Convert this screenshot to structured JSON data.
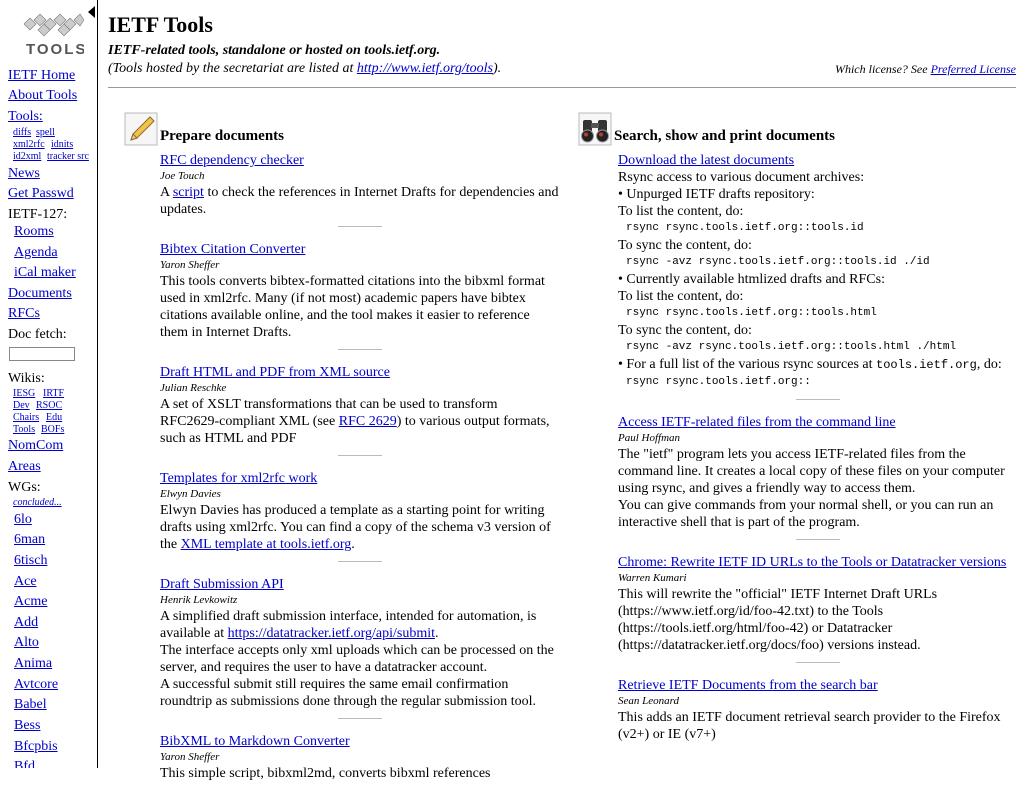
{
  "header": {
    "title": "IETF Tools",
    "subtitle": "IETF-related tools, standalone or hosted on tools.ietf.org.",
    "note_prefix": "(Tools hosted by the secretariat are listed at ",
    "note_link": "http://www.ietf.org/tools",
    "note_suffix": ").",
    "license_prefix": "Which license? See ",
    "license_link": "Preferred License"
  },
  "sidebar": {
    "ietf_home": "IETF Home",
    "about_tools": "About Tools",
    "tools_label": "Tools:",
    "tool_links": [
      "diffs",
      "spell",
      "xml2rfc",
      "idnits",
      "id2xml",
      "tracker src"
    ],
    "news": "News",
    "get_passwd": "Get Passwd",
    "ietf127_label": "IETF-127:",
    "ietf127_links": [
      "Rooms",
      "Agenda",
      "iCal maker"
    ],
    "documents": "Documents",
    "rfcs": "RFCs",
    "doc_fetch_label": "Doc fetch:",
    "wikis_label": "Wikis:",
    "wiki_links": [
      "IESG",
      "IRTF",
      "Dev",
      "RSOC",
      "Chairs",
      "Edu",
      "Tools",
      "BOFs"
    ],
    "nomcom": "NomCom",
    "areas": "Areas",
    "wgs_label": "WGs:",
    "concluded": "concluded...",
    "wg_links": [
      "6lo",
      "6man",
      "6tisch",
      "Ace",
      "Acme",
      "Add",
      "Alto",
      "Anima",
      "Avtcore",
      "Babel",
      "Bess",
      "Bfcpbis",
      "Bfd"
    ]
  },
  "left_section": {
    "title": "Prepare documents",
    "icon": "pencil-document-icon",
    "entries": [
      {
        "title": "RFC dependency checker",
        "author": "Joe Touch",
        "desc": [
          "A ",
          "script",
          " to check the references in Internet Drafts for dependencies and updates."
        ]
      },
      {
        "title": "Bibtex Citation Converter",
        "author": "Yaron Sheffer",
        "desc": [
          "This tools converts bibtex-formatted citations into the bibxml format used in xml2rfc. Many (if not most) academic papers have bibtex citations available online, and the tool makes it easier to reference them in Internet Drafts."
        ]
      },
      {
        "title": "Draft HTML and PDF from XML source",
        "author": "Julian Reschke",
        "desc": [
          "A set of XSLT transformations that can be used to transform RFC2629-compliant XML (see ",
          "RFC 2629",
          ") to various output formats, such as HTML and PDF"
        ]
      },
      {
        "title": "Templates for xml2rfc work",
        "author": "Elwyn Davies",
        "desc": [
          "Elwyn Davies has produced a template as a starting point for writing drafts using xml2rfc. You can find a copy of the schema v3 version of the ",
          "XML template at tools.ietf.org",
          "."
        ]
      },
      {
        "title": "Draft Submission API",
        "author": "Henrik Levkowitz",
        "desc": [
          "A simplified draft submission interface, intended for automation, is available at ",
          "https://datatracker.ietf.org/api/submit",
          ".",
          "The interface accepts only xml uploads which can be processed on the server, and requires the user to have a datatracker account.",
          "A successful submit still requires the same email confirmation roundtrip as submissions done through the regular submission tool."
        ]
      },
      {
        "title": "BibXML to Markdown Converter",
        "author": "Yaron Sheffer",
        "desc": [
          "This simple script, bibxml2md, converts bibxml references"
        ]
      }
    ]
  },
  "right_section": {
    "title": "Search, show and print documents",
    "icon": "binoculars-icon",
    "rsync": {
      "title": "Download the latest documents",
      "intro": "Rsync access to various document archives:",
      "unpurged": "• Unpurged IETF drafts repository:",
      "list_label": "To list the content, do:",
      "cmd1": "rsync rsync.tools.ietf.org::tools.id",
      "sync_label": "To sync the content, do:",
      "cmd2": "rsync -avz rsync.tools.ietf.org::tools.id ./id",
      "htmlized": "• Currently available htmlized drafts and RFCs:",
      "list_label2": "To list the content, do:",
      "cmd3": "rsync rsync.tools.ietf.org::tools.html",
      "sync_label2": "To sync the content, do:",
      "cmd4": "rsync -avz rsync.tools.ietf.org::tools.html ./html",
      "full_list_a": "• For a full list of the various rsync sources at ",
      "full_list_code": "tools.ietf.org",
      "full_list_b": ", do:",
      "cmd5": "rsync rsync.tools.ietf.org::"
    },
    "entries": [
      {
        "title": "Access IETF-related files from the command line",
        "author": "Paul Hoffman",
        "desc": [
          "The \"ietf\" program lets you access IETF-related files from the command line. It creates a local copy of these files on your computer using rsync, and gives a friendly way to access them.",
          "You can give commands from your normal shell, or you can run an interactive shell that is part of the program."
        ]
      },
      {
        "title": "Chrome: Rewrite IETF ID URLs to the Tools or Datatracker versions",
        "author": "Warren Kumari",
        "desc": [
          "This will rewrite the \"official\" IETF Internet Draft URLs (https://www.ietf.org/id/foo-42.txt) to the Tools (https://tools.ietf.org/html/foo-42) or Datatracker (https://datatracker.ietf.org/docs/foo) versions instead."
        ]
      },
      {
        "title": "Retrieve IETF Documents from the search bar",
        "author": "Sean Leonard",
        "desc": [
          "This adds an IETF document retrieval search provider to the Firefox (v2+) or IE (v7+)"
        ]
      }
    ]
  }
}
